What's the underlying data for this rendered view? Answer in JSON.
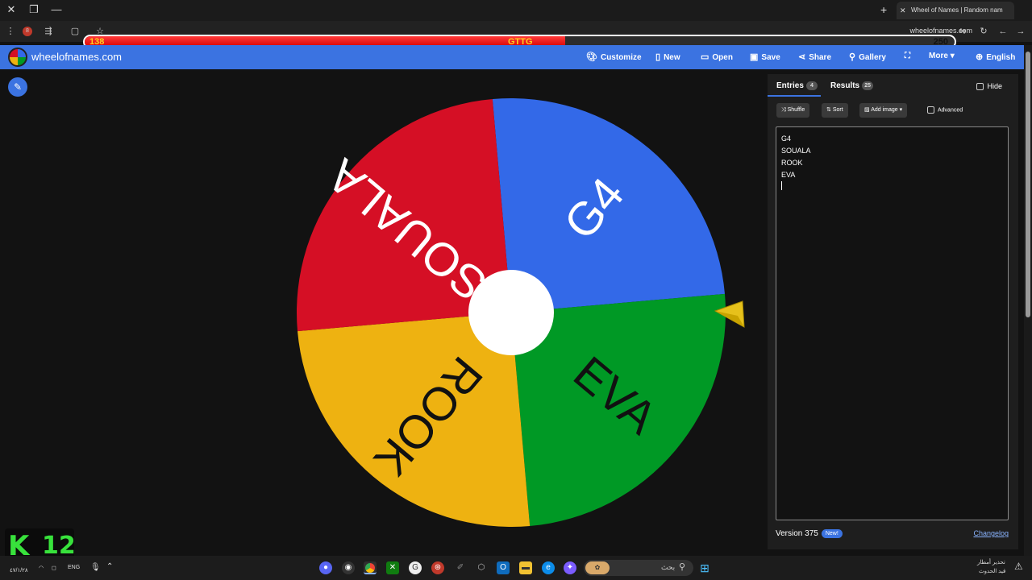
{
  "browser": {
    "tab_title": "Wheel of Names | Random nam",
    "url": "wheelofnames.com"
  },
  "overlay": {
    "hp_left": "138",
    "hp_center": "GTTG",
    "hp_right": "250",
    "hp_fraction": 0.552
  },
  "app": {
    "site_name": "wheelofnames.com",
    "menu": {
      "customize": "Customize",
      "new": "New",
      "open": "Open",
      "save": "Save",
      "share": "Share",
      "gallery": "Gallery",
      "more": "More",
      "language": "English"
    }
  },
  "wheel": {
    "segments": [
      {
        "label": "G4",
        "color": "#3369e8"
      },
      {
        "label": "EVA",
        "color": "#009925"
      },
      {
        "label": "ROOK",
        "color": "#eeb211"
      },
      {
        "label": "SOUALA",
        "color": "#d50f25"
      }
    ]
  },
  "panel": {
    "entries_tab": "Entries",
    "entries_count": "4",
    "results_tab": "Results",
    "results_count": "25",
    "hide_label": "Hide",
    "shuffle": "Shuffle",
    "sort": "Sort",
    "add_image": "Add image",
    "advanced": "Advanced",
    "entries": [
      "G4",
      "SOUALA",
      "ROOK",
      "EVA"
    ],
    "version": "Version 375",
    "new_badge": "New!",
    "changelog": "Changelog"
  },
  "taskbar": {
    "lang": "ENG",
    "date": "٤٧/١/٢٨",
    "search_text": "بحث",
    "weather_line1": "تحذير أمطار",
    "weather_line2": "قيد الحدوث"
  },
  "watermark": {
    "letter": "K",
    "number": "12"
  }
}
